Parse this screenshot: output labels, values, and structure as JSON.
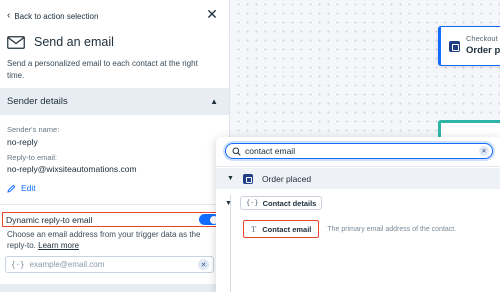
{
  "panel": {
    "back_label": "Back to action selection",
    "title": "Send an email",
    "description": "Send a personalized email to each contact at the right time.",
    "sender_section": {
      "title": "Sender details",
      "name_label": "Sender's name:",
      "name_value": "no-reply",
      "reply_label": "Reply-to email:",
      "reply_value": "no-reply@wixsiteautomations.com",
      "edit_label": "Edit"
    },
    "dynamic_reply": {
      "label": "Dynamic reply-to email",
      "enabled": true,
      "description": "Choose an email address from your trigger data as the reply-to.",
      "learn_more": "Learn more",
      "input_prefix": "{·}",
      "input_placeholder": "example@email.com"
    }
  },
  "canvas": {
    "node_top": {
      "subtitle": "Checkout",
      "title": "Order p"
    }
  },
  "popup": {
    "search_value": "contact email",
    "trigger_label": "Order placed",
    "group_prefix": "{·}",
    "group_label": "Contact details",
    "field": {
      "type_glyph": "T",
      "label": "Contact email",
      "description": "The primary email address of the contact."
    }
  },
  "colors": {
    "accent": "#116dff",
    "highlight": "#e8452c",
    "section_bg": "#e8edf4",
    "trigger_icon": "#1f3e85",
    "teal": "#2fb5a8"
  },
  "icons": [
    "chevron-left-icon",
    "close-icon",
    "envelope-icon",
    "chevron-up-icon",
    "pencil-icon",
    "search-icon",
    "clear-icon",
    "caret-down-icon",
    "order-icon",
    "text-type-icon"
  ]
}
